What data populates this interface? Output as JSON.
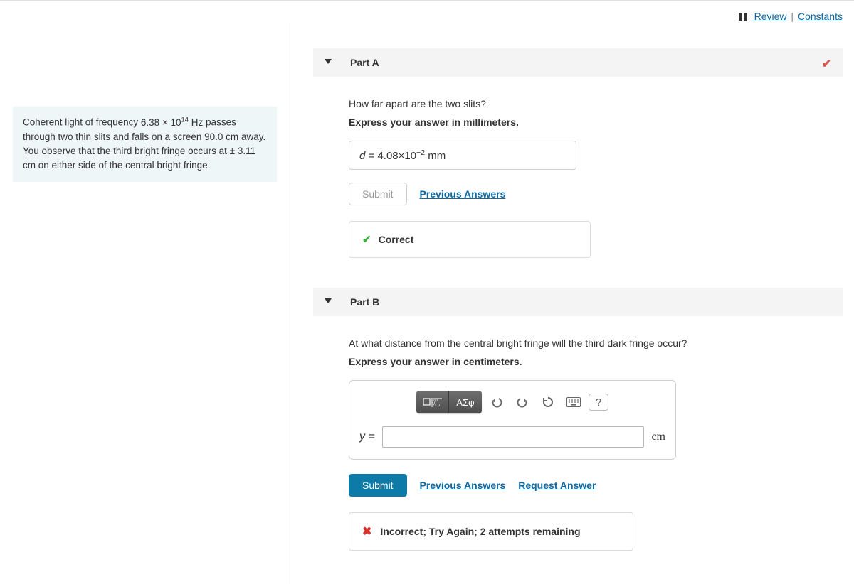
{
  "toplinks": {
    "review": "Review",
    "constants": "Constants"
  },
  "problem": {
    "text_pre": "Coherent light of frequency ",
    "freq_val": "6.38 × 10",
    "freq_exp": "14",
    "freq_unit": " Hz",
    "text_mid1": " passes through two thin slits and falls on a screen ",
    "dist": "90.0 cm",
    "text_mid2": " away. You observe that the third bright fringe occurs at ",
    "pm": "± ",
    "fringe": "3.11 cm",
    "text_end": " on either side of the central bright fringe."
  },
  "partA": {
    "title": "Part A",
    "question": "How far apart are the two slits?",
    "instruction": "Express your answer in millimeters.",
    "answer_lhs": "d",
    "answer_eq": " = ",
    "answer_val_pre": "4.08×10",
    "answer_val_exp": "−2",
    "answer_unit": " mm",
    "submit": "Submit",
    "prev": "Previous Answers",
    "feedback": "Correct"
  },
  "partB": {
    "title": "Part B",
    "question": "At what distance from the central bright fringe will the third dark fringe occur?",
    "instruction": "Express your answer in centimeters.",
    "greek_btn": "ΑΣφ",
    "lhs": "y = ",
    "unit": "cm",
    "submit": "Submit",
    "prev": "Previous Answers",
    "req": "Request Answer",
    "feedback": "Incorrect; Try Again; 2 attempts remaining"
  }
}
